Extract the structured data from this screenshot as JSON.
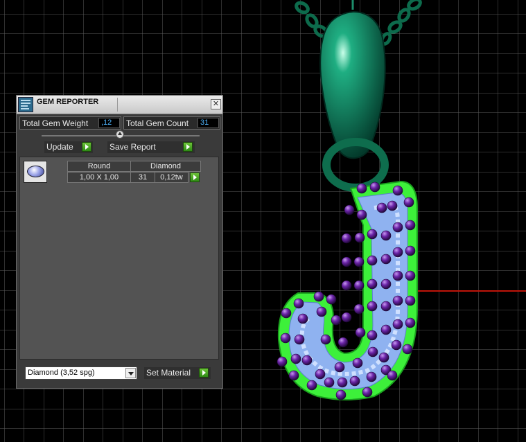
{
  "window": {
    "title": "GEM REPORTER",
    "close_glyph": "✕",
    "icon": "gem-reporter-app-icon"
  },
  "stats": {
    "total_gem_weight_label": "Total Gem Weight",
    "total_gem_weight_value": ",12",
    "total_gem_count_label": "Total Gem Count",
    "total_gem_count_value": "31"
  },
  "actions": {
    "update_label": "Update",
    "save_report_label": "Save Report"
  },
  "gem_list": {
    "rows": [
      {
        "shape": "Round",
        "material": "Diamond",
        "size": "1,00 X 1,00",
        "count": "31",
        "weight": "0,12tw"
      }
    ]
  },
  "material": {
    "selected": "Diamond      (3,52 spg)",
    "set_label": "Set Material"
  },
  "scene": {
    "colors": {
      "grid": "#5a5a5a",
      "chain": "#0a6a4a",
      "body": "#3df03a",
      "pave": "#8fb2f0",
      "prong": "#5a1e8a",
      "axis": "#c0150a"
    }
  }
}
